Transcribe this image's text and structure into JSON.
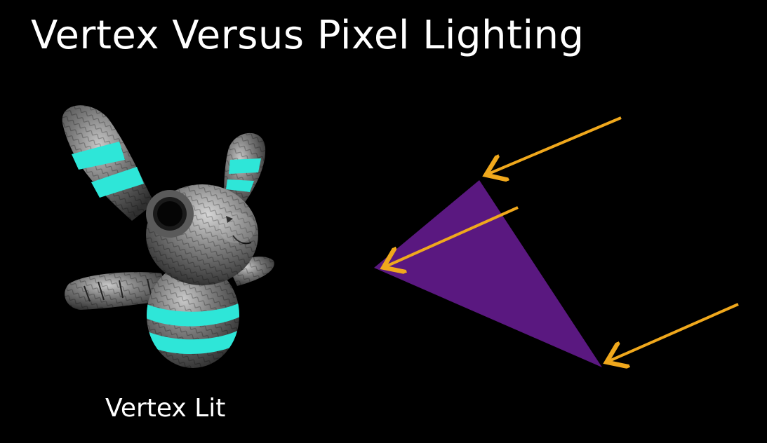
{
  "slide": {
    "title": "Vertex Versus Pixel Lighting",
    "caption": "Vertex Lit"
  },
  "colors": {
    "background": "#000000",
    "text": "#ffffff",
    "triangle": "#5a1880",
    "arrow": "#f0a81c",
    "bunny_body": "#6e6e6e",
    "bunny_stripes": "#2ee6d8"
  },
  "illustrations": {
    "model": "stitched-plush-bunny-image",
    "diagram": "triangle-with-light-arrows-image"
  }
}
